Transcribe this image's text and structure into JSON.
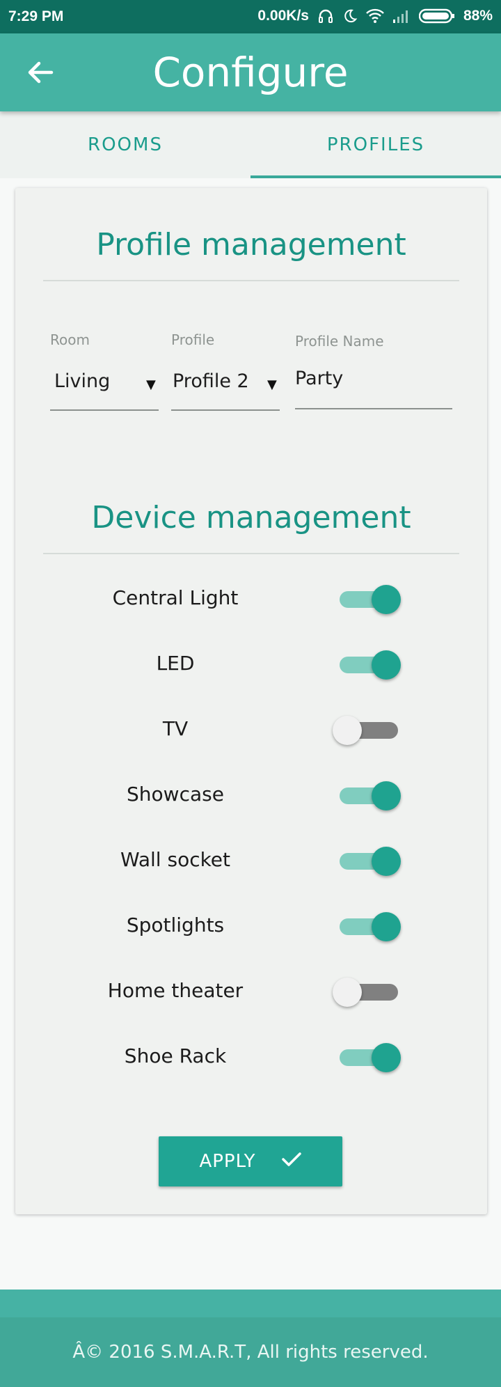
{
  "status_bar": {
    "time": "7:29 PM",
    "speed": "0.00K/s",
    "battery": "88%",
    "icons": [
      "headphones-icon",
      "moon-icon",
      "wifi-icon",
      "signal-icon",
      "battery-icon"
    ]
  },
  "app_bar": {
    "title": "Configure",
    "back_icon": "arrow-left-icon"
  },
  "tabs": [
    {
      "label": "ROOMS",
      "selected": false
    },
    {
      "label": "PROFILES",
      "selected": true
    }
  ],
  "profile_section": {
    "title": "Profile management",
    "room": {
      "label": "Room",
      "value": "Living"
    },
    "profile": {
      "label": "Profile",
      "value": "Profile 2"
    },
    "profile_name": {
      "label": "Profile Name",
      "value": "Party"
    },
    "dropdown_arrow": "▼"
  },
  "device_section": {
    "title": "Device management",
    "devices": [
      {
        "name": "Central Light",
        "on": true
      },
      {
        "name": "LED",
        "on": true
      },
      {
        "name": "TV",
        "on": false
      },
      {
        "name": "Showcase",
        "on": true
      },
      {
        "name": "Wall socket",
        "on": true
      },
      {
        "name": "Spotlights",
        "on": true
      },
      {
        "name": "Home theater",
        "on": false
      },
      {
        "name": "Shoe Rack",
        "on": true
      }
    ]
  },
  "apply_button": {
    "label": "APPLY",
    "icon": "check-icon"
  },
  "footer": {
    "text": "Â© 2016 S.M.A.R.T, All rights reserved."
  },
  "colors": {
    "primary": "#45b3a3",
    "accent": "#1fa390",
    "status_bar": "#0e6e5f"
  }
}
